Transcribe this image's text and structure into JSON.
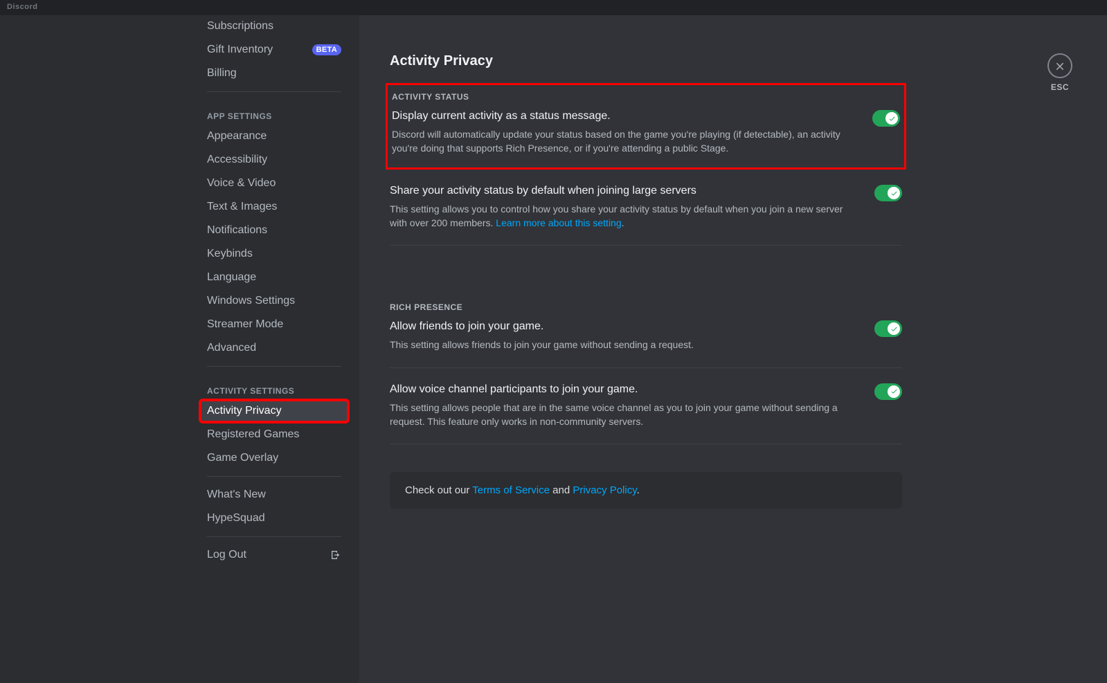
{
  "app_title": "Discord",
  "close_label": "ESC",
  "sidebar": {
    "billing_items": [
      {
        "label": "Subscriptions"
      },
      {
        "label": "Gift Inventory",
        "badge": "BETA"
      },
      {
        "label": "Billing"
      }
    ],
    "app_header": "APP SETTINGS",
    "app_items": [
      "Appearance",
      "Accessibility",
      "Voice & Video",
      "Text & Images",
      "Notifications",
      "Keybinds",
      "Language",
      "Windows Settings",
      "Streamer Mode",
      "Advanced"
    ],
    "activity_header": "ACTIVITY SETTINGS",
    "activity_items": [
      {
        "label": "Activity Privacy",
        "active": true
      },
      {
        "label": "Registered Games"
      },
      {
        "label": "Game Overlay"
      }
    ],
    "extra_items": [
      "What's New",
      "HypeSquad"
    ],
    "logout": "Log Out"
  },
  "page": {
    "title": "Activity Privacy",
    "sections": {
      "activity_status": {
        "header": "ACTIVITY STATUS",
        "items": [
          {
            "title": "Display current activity as a status message.",
            "desc": "Discord will automatically update your status based on the game you're playing (if detectable), an activity you're doing that supports Rich Presence, or if you're attending a public Stage.",
            "toggle": true
          },
          {
            "title": "Share your activity status by default when joining large servers",
            "desc_pre": "This setting allows you to control how you share your activity status by default when you join a new server with over 200 members. ",
            "link": "Learn more about this setting",
            "desc_post": ".",
            "toggle": true
          }
        ]
      },
      "rich_presence": {
        "header": "RICH PRESENCE",
        "items": [
          {
            "title": "Allow friends to join your game.",
            "desc": "This setting allows friends to join your game without sending a request.",
            "toggle": true
          },
          {
            "title": "Allow voice channel participants to join your game.",
            "desc": "This setting allows people that are in the same voice channel as you to join your game without sending a request. This feature only works in non-community servers.",
            "toggle": true
          }
        ]
      }
    },
    "tos": {
      "pre": "Check out our ",
      "link1": "Terms of Service",
      "mid": " and ",
      "link2": "Privacy Policy",
      "post": "."
    }
  }
}
